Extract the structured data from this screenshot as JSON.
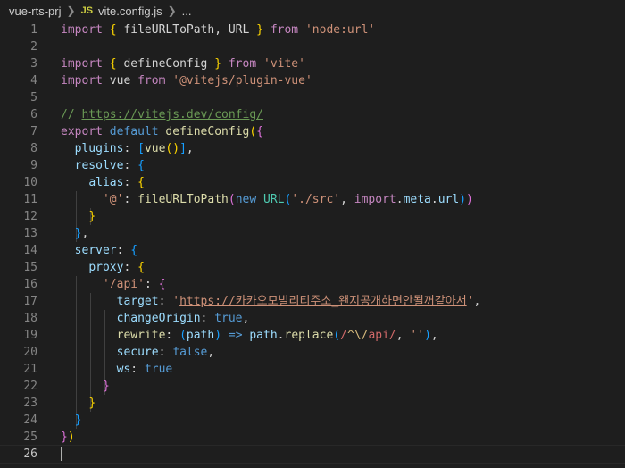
{
  "breadcrumb": {
    "folder": "vue-rts-prj",
    "file_icon": "JS",
    "file": "vite.config.js",
    "more": "..."
  },
  "line_numbers": [
    "1",
    "2",
    "3",
    "4",
    "5",
    "6",
    "7",
    "8",
    "9",
    "10",
    "11",
    "12",
    "13",
    "14",
    "15",
    "16",
    "17",
    "18",
    "19",
    "20",
    "21",
    "22",
    "23",
    "24",
    "25",
    "26"
  ],
  "code": {
    "l1": [
      "import",
      " ",
      "{",
      " fileURLToPath, URL ",
      "}",
      " ",
      "from",
      " ",
      "'node:url'"
    ],
    "l3": [
      "import",
      " ",
      "{",
      " defineConfig ",
      "}",
      " ",
      "from",
      " ",
      "'vite'"
    ],
    "l4": [
      "import",
      " vue ",
      "from",
      " ",
      "'@vitejs/plugin-vue'"
    ],
    "l6": [
      "// ",
      "https://vitejs.dev/config/"
    ],
    "l7": [
      "export",
      " ",
      "default",
      " ",
      "defineConfig",
      "(",
      "{"
    ],
    "l8": [
      "  ",
      "plugins",
      ": ",
      "[",
      "vue",
      "(",
      ")",
      "]",
      ","
    ],
    "l9": [
      "  ",
      "resolve",
      ": ",
      "{"
    ],
    "l10": [
      "    ",
      "alias",
      ": ",
      "{"
    ],
    "l11": [
      "      ",
      "'@'",
      ": ",
      "fileURLToPath",
      "(",
      "new",
      " ",
      "URL",
      "(",
      "'./src'",
      ", ",
      "import",
      ".",
      "meta",
      ".",
      "url",
      ")",
      ")"
    ],
    "l12": [
      "    ",
      "}"
    ],
    "l13": [
      "  ",
      "}",
      ","
    ],
    "l14": [
      "  ",
      "server",
      ": ",
      "{"
    ],
    "l15": [
      "    ",
      "proxy",
      ": ",
      "{"
    ],
    "l16": [
      "      ",
      "'/api'",
      ": ",
      "{"
    ],
    "l17": [
      "        ",
      "target",
      ": ",
      "'",
      "https://카카오모빌리티주소_왠지공개하면안될꺼같아서",
      "'",
      ","
    ],
    "l18": [
      "        ",
      "changeOrigin",
      ": ",
      "true",
      ","
    ],
    "l19": [
      "        ",
      "rewrite",
      ": ",
      "(",
      "path",
      ")",
      " => ",
      "path",
      ".",
      "replace",
      "(",
      "/",
      "^",
      "\\/",
      "api",
      "/",
      ", ",
      "''",
      ")",
      ","
    ],
    "l20": [
      "        ",
      "secure",
      ": ",
      "false",
      ","
    ],
    "l21": [
      "        ",
      "ws",
      ": ",
      "true"
    ],
    "l22": [
      "      ",
      "}"
    ],
    "l23": [
      "    ",
      "}"
    ],
    "l24": [
      "  ",
      "}"
    ],
    "l25": [
      "}",
      ")"
    ]
  },
  "colors": {
    "background": "#1e1e1e",
    "keyword": "#c586c0",
    "function": "#dcdcaa",
    "string": "#ce9178",
    "comment": "#6a9955"
  },
  "icons": [
    "chevron-right-icon",
    "js-file-icon"
  ]
}
